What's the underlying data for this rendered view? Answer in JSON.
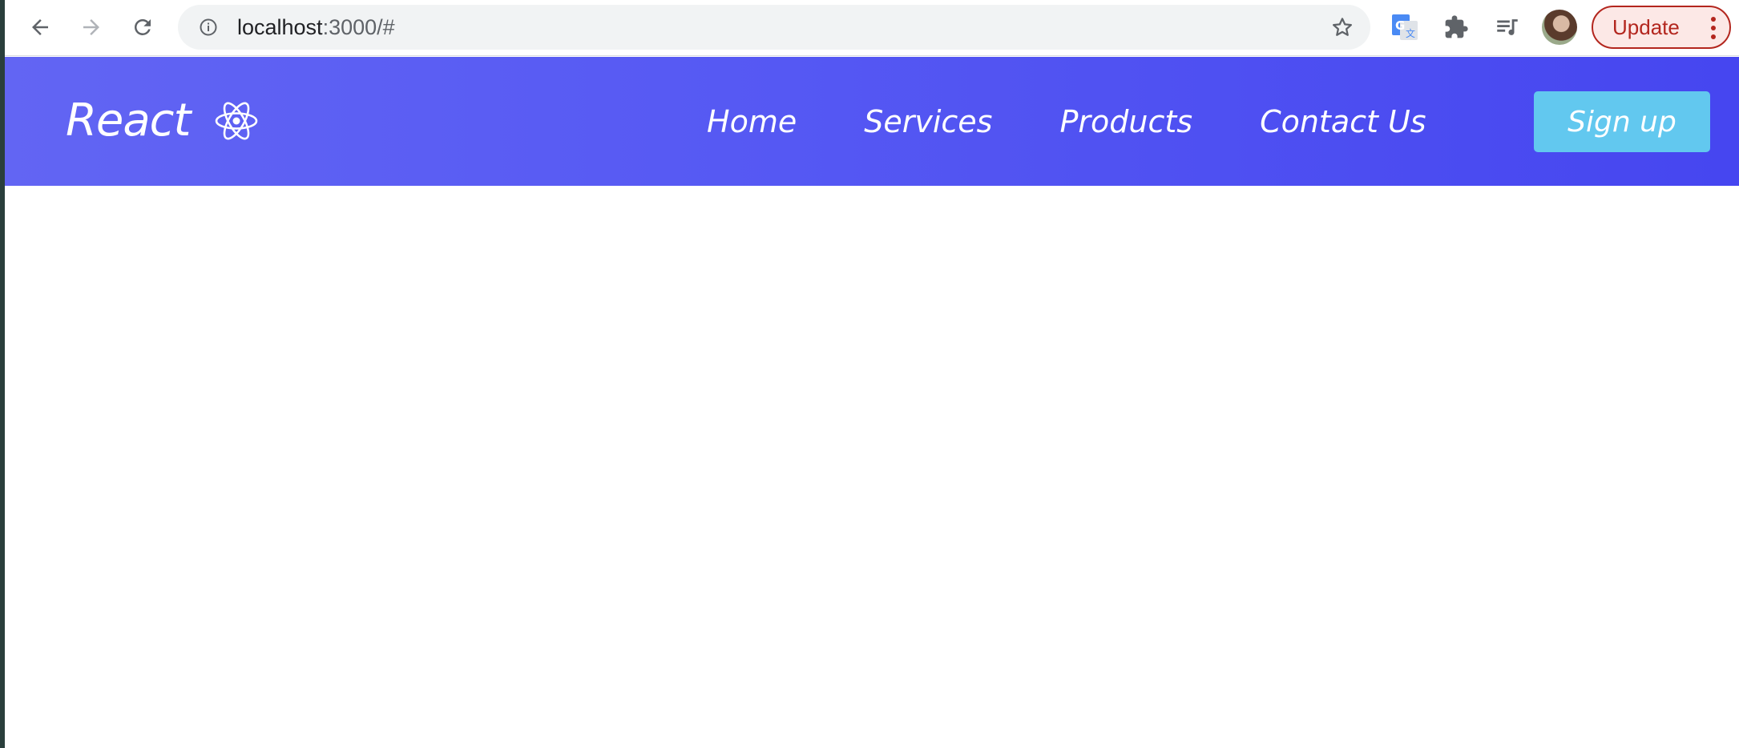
{
  "browser": {
    "url_host": "localhost",
    "url_path": ":3000/#",
    "update_label": "Update",
    "icons": [
      "back-arrow-icon",
      "forward-arrow-icon",
      "reload-icon",
      "info-icon",
      "star-icon",
      "google-translate-icon",
      "puzzle-icon",
      "media-queue-icon",
      "profile-avatar",
      "kebab-menu-icon"
    ]
  },
  "navbar": {
    "logo_text": "React",
    "logo_icon": "react-atom-icon",
    "links": [
      "Home",
      "Services",
      "Products",
      "Contact Us"
    ],
    "signup_label": "Sign up",
    "colors": {
      "gradient_start": "#6265f3",
      "gradient_end": "#4646f0",
      "signup_bg": "#62c8ef",
      "text": "#ffffff"
    }
  }
}
